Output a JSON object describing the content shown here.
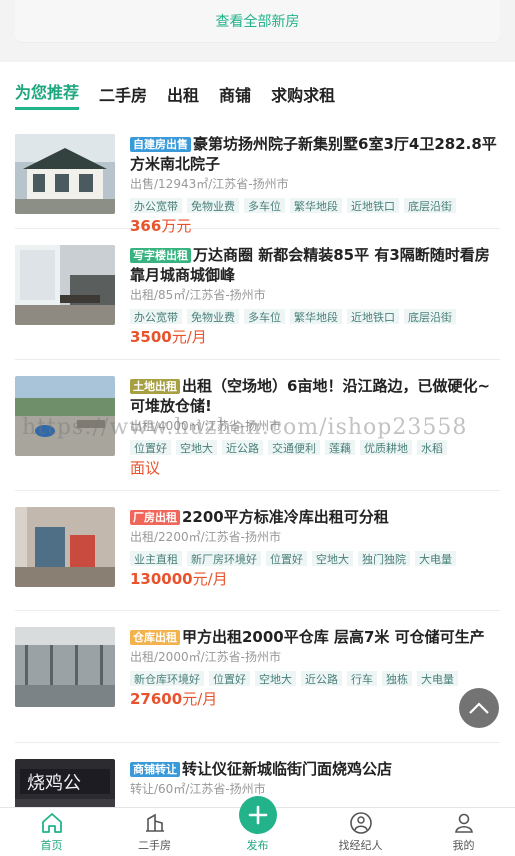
{
  "top": {
    "view_all": "查看全部新房"
  },
  "tabs": [
    "为您推荐",
    "二手房",
    "出租",
    "商铺",
    "求购求租"
  ],
  "listings": [
    {
      "badge": "自建房出售",
      "badge_color": "#3a9ad9",
      "title": "豪第坊扬州院子新集别墅6室3厅4卫282.8平方米南北院子",
      "meta": "出售/12943㎡/江苏省-扬州市",
      "tags": [
        "办公宽带",
        "免物业费",
        "多车位",
        "繁华地段",
        "近地铁口",
        "底层沿街"
      ],
      "price_num": "366",
      "price_unit": "万元"
    },
    {
      "badge": "写字楼出租",
      "badge_color": "#36b37e",
      "title": "万达商圈 新都会精装85平 有3隔断随时看房 靠月城商城御峰",
      "meta": "出租/85㎡/江苏省-扬州市",
      "tags": [
        "办公宽带",
        "免物业费",
        "多车位",
        "繁华地段",
        "近地铁口",
        "底层沿街"
      ],
      "price_num": "3500",
      "price_unit": "元/月"
    },
    {
      "badge": "土地出租",
      "badge_color": "#a6a043",
      "title": "出租（空场地）6亩地！沿江路边，已做硬化~可堆放仓储!",
      "meta": "出租/4000㎡/江苏省-扬州市",
      "tags": [
        "位置好",
        "空地大",
        "近公路",
        "交通便利",
        "莲藕",
        "优质耕地",
        "水稻"
      ],
      "price_num": "",
      "price_unit": "面议"
    },
    {
      "badge": "厂房出租",
      "badge_color": "#f0665a",
      "title": "2200平方标准冷库出租可分租",
      "meta": "出租/2200㎡/江苏省-扬州市",
      "tags": [
        "业主直租",
        "新厂房环境好",
        "位置好",
        "空地大",
        "独门独院",
        "大电量"
      ],
      "price_num": "130000",
      "price_unit": "元/月"
    },
    {
      "badge": "仓库出租",
      "badge_color": "#f2b24c",
      "title": "甲方出租2000平仓库 层高7米 可仓储可生产",
      "meta": "出租/2000㎡/江苏省-扬州市",
      "tags": [
        "新仓库环境好",
        "位置好",
        "空地大",
        "近公路",
        "行车",
        "独栋",
        "大电量"
      ],
      "price_num": "27600",
      "price_unit": "元/月"
    },
    {
      "badge": "商铺转让",
      "badge_color": "#3a9ad9",
      "title": "转让仪征新城临街门面烧鸡公店",
      "meta": "转让/60㎡/江苏省-扬州市",
      "tags": [],
      "price_num": "",
      "price_unit": ""
    }
  ],
  "watermark": "https://www.huzhan.com/ishop23558",
  "nav": [
    "首页",
    "二手房",
    "发布",
    "找经纪人",
    "我的"
  ],
  "colors": {
    "accent": "#22b38a",
    "price": "#e8532d"
  }
}
